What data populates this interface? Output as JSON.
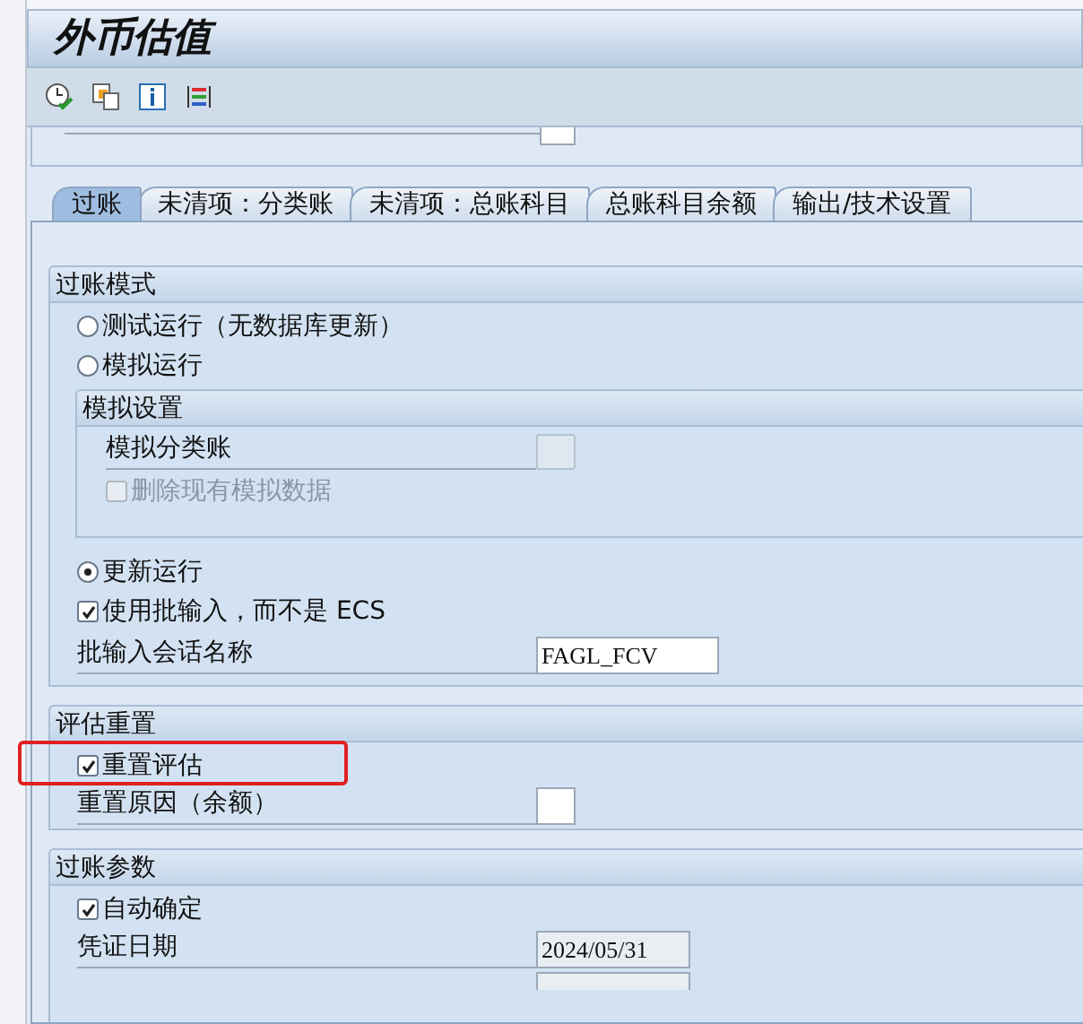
{
  "window": {
    "title": "外币估值"
  },
  "tabs": [
    {
      "label": "过账",
      "selected": true
    },
    {
      "label": "未清项：分类账",
      "selected": false
    },
    {
      "label": "未清项：总账科目",
      "selected": false
    },
    {
      "label": "总账科目余额",
      "selected": false
    },
    {
      "label": "输出/技术设置",
      "selected": false
    }
  ],
  "posting_mode": {
    "title": "过账模式",
    "options_top": [
      {
        "kind": "radio",
        "label": "测试运行（无数据库更新）",
        "selected": false
      },
      {
        "kind": "radio",
        "label": "模拟运行",
        "selected": false
      }
    ],
    "simulation": {
      "title": "模拟设置",
      "ledger_label": "模拟分类账",
      "delete_label": "删除现有模拟数据",
      "delete_checked": false,
      "delete_disabled": true
    },
    "options_bottom": [
      {
        "kind": "radio",
        "label": "更新运行",
        "selected": true
      },
      {
        "kind": "checkbox",
        "label": "使用批输入，而不是 ECS",
        "checked": true
      }
    ],
    "session_label": "批输入会话名称",
    "session_value": "FAGL_FCV"
  },
  "reset": {
    "title": "评估重置",
    "checkbox_label": "重置评估",
    "checked": true,
    "highlighted": true,
    "reason_label": "重置原因（余额）"
  },
  "posting_params": {
    "title": "过账参数",
    "checkbox_label": "自动确定",
    "checked": true,
    "doc_date_label": "凭证日期",
    "doc_date_value": "2024/05/31"
  }
}
